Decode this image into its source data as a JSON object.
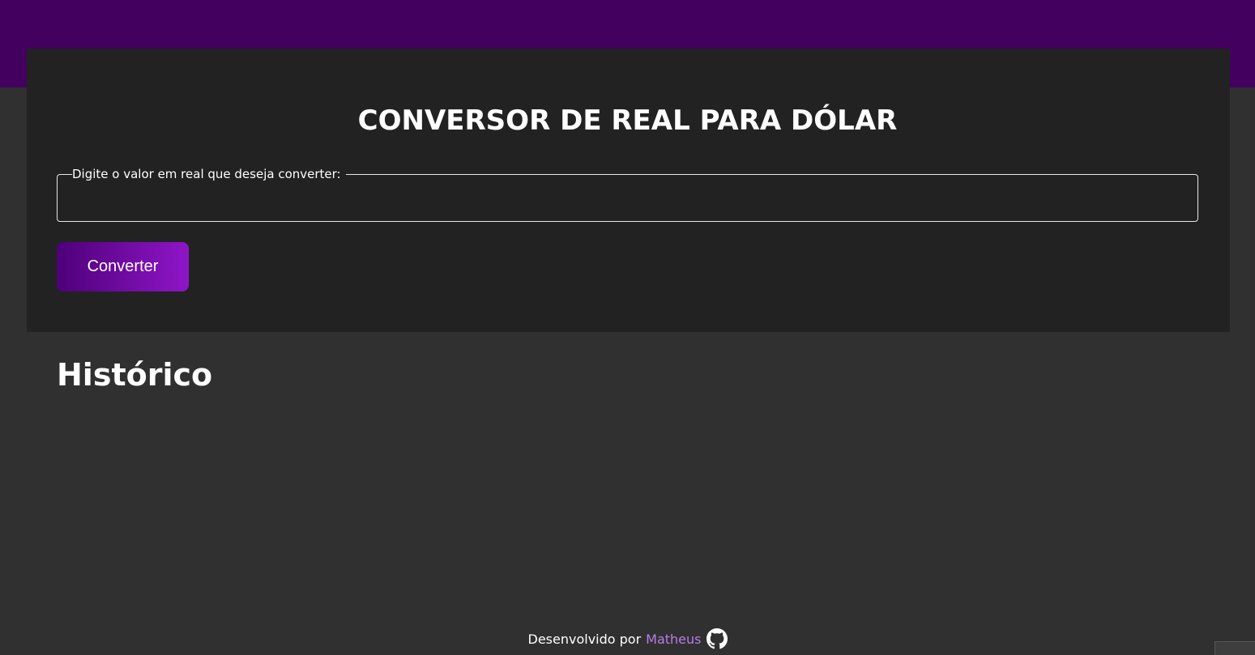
{
  "app": {
    "title": "CONVERSOR DE REAL PARA DÓLAR",
    "accent_color": "#43005f",
    "card_color": "#222222",
    "background_color": "#303030"
  },
  "form": {
    "amount_label": "Digite o valor em real que deseja converter:",
    "amount_value": "",
    "convert_button_label": "Converter"
  },
  "history": {
    "title": "Histórico",
    "items": []
  },
  "footer": {
    "label": "Desenvolvido por",
    "author_link_text": "Matheus",
    "author_link_color": "#b57ee6",
    "icon": "github-icon"
  }
}
